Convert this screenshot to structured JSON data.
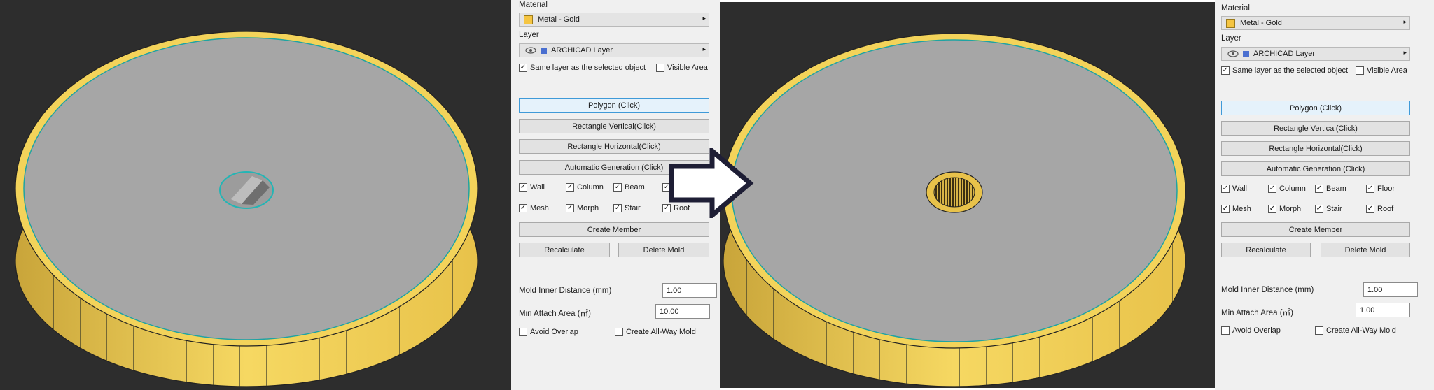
{
  "panel": {
    "material_label": "Material",
    "material_value": "Metal - Gold",
    "layer_label": "Layer",
    "layer_value": "ARCHICAD Layer",
    "same_layer_label": "Same layer as the selected object",
    "same_layer_checked": true,
    "visible_area_label": "Visible Area",
    "visible_area_checked": false,
    "polygon_button": "Polygon (Click)",
    "rect_vertical_button": "Rectangle Vertical(Click)",
    "rect_horizontal_button": "Rectangle Horizontal(Click)",
    "auto_gen_button": "Automatic Generation (Click)",
    "elements": {
      "wall": "Wall",
      "column": "Column",
      "beam": "Beam",
      "floor": "Floor",
      "mesh": "Mesh",
      "morph": "Morph",
      "stair": "Stair",
      "roof": "Roof"
    },
    "create_member_button": "Create Member",
    "recalculate_button": "Recalculate",
    "delete_mold_button": "Delete Mold",
    "mold_inner_distance_label": "Mold Inner Distance (mm)",
    "min_attach_area_label": "Min Attach Area (㎡)",
    "avoid_overlap_label": "Avoid Overlap",
    "create_all_way_mold_label": "Create All-Way Mold"
  },
  "before": {
    "mold_inner_distance_value": "1.00",
    "min_attach_area_value": "10.00"
  },
  "after": {
    "mold_inner_distance_value": "1.00",
    "min_attach_area_value": "1.00"
  },
  "colors": {
    "viewport_bg": "#2d2d2d",
    "disk_top": "#a6a6a6",
    "disk_side": "#f3d35a",
    "panel_bg": "#f0f0f0",
    "highlight_border": "#3f9ad8",
    "material_swatch": "#f5c542"
  },
  "icons": [
    "eye-icon",
    "layer-icon",
    "dropdown-arrow-icon",
    "right-arrow-icon",
    "checkbox-checked-icon"
  ]
}
